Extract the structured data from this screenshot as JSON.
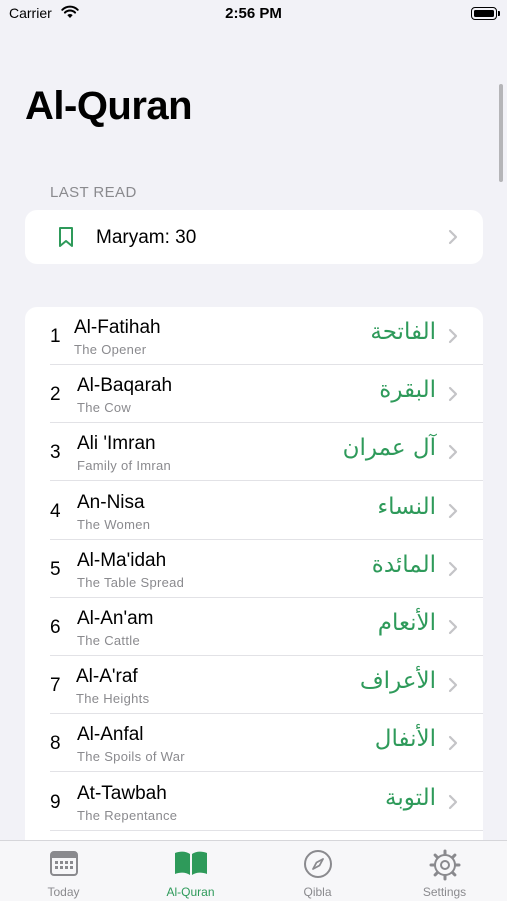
{
  "status_bar": {
    "carrier": "Carrier",
    "time": "2:56 PM"
  },
  "page": {
    "title": "Al-Quran"
  },
  "last_read": {
    "header": "LAST READ",
    "label": "Maryam: 30"
  },
  "surahs": [
    {
      "number": "1",
      "name": "Al-Fatihah",
      "meaning": "The Opener",
      "arabic": "الفاتحة"
    },
    {
      "number": "2",
      "name": "Al-Baqarah",
      "meaning": "The Cow",
      "arabic": "البقرة"
    },
    {
      "number": "3",
      "name": "Ali 'Imran",
      "meaning": "Family of Imran",
      "arabic": "آل عمران"
    },
    {
      "number": "4",
      "name": "An-Nisa",
      "meaning": "The Women",
      "arabic": "النساء"
    },
    {
      "number": "5",
      "name": "Al-Ma'idah",
      "meaning": "The Table Spread",
      "arabic": "المائدة"
    },
    {
      "number": "6",
      "name": "Al-An'am",
      "meaning": "The Cattle",
      "arabic": "الأنعام"
    },
    {
      "number": "7",
      "name": "Al-A'raf",
      "meaning": "The Heights",
      "arabic": "الأعراف"
    },
    {
      "number": "8",
      "name": "Al-Anfal",
      "meaning": "The Spoils of War",
      "arabic": "الأنفال"
    },
    {
      "number": "9",
      "name": "At-Tawbah",
      "meaning": "The Repentance",
      "arabic": "التوبة"
    }
  ],
  "tabs": [
    {
      "label": "Today",
      "icon": "calendar-icon",
      "active": false
    },
    {
      "label": "Al-Quran",
      "icon": "book-icon",
      "active": true
    },
    {
      "label": "Qibla",
      "icon": "compass-icon",
      "active": false
    },
    {
      "label": "Settings",
      "icon": "gear-icon",
      "active": false
    }
  ],
  "colors": {
    "accent": "#2e9a5a",
    "secondary_text": "#8a8a8e",
    "background": "#f2f2f7"
  }
}
